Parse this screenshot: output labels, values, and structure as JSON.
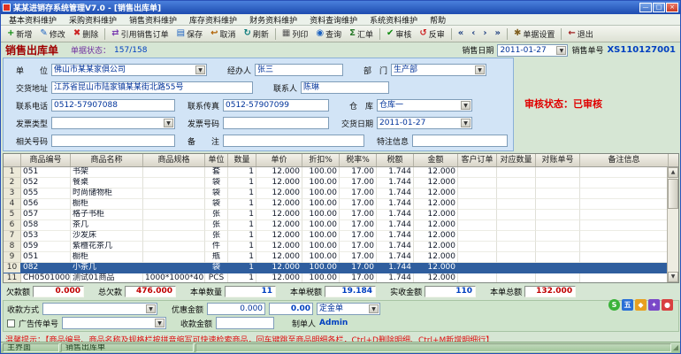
{
  "window": {
    "title": "某某进销存系统管理V7.0 - [销售出库单]",
    "controls": {
      "min": "—",
      "max": "□",
      "close": "×"
    }
  },
  "menu": {
    "items": [
      "基本资料维护",
      "采购资料维护",
      "销售资料维护",
      "库存资料维护",
      "财务资料维护",
      "资料查询维护",
      "系统资料维护",
      "帮助"
    ]
  },
  "toolbar": {
    "groups": [
      [
        {
          "label": "新增",
          "icon": "new-icon"
        },
        {
          "label": "修改",
          "icon": "edit-icon"
        },
        {
          "label": "删除",
          "icon": "delete-icon"
        }
      ],
      [
        {
          "label": "引用销售订单",
          "icon": "ref-order-icon"
        },
        {
          "label": "保存",
          "icon": "save-icon"
        },
        {
          "label": "取消",
          "icon": "cancel-icon"
        },
        {
          "label": "刷新",
          "icon": "refresh-icon"
        }
      ],
      [
        {
          "label": "列印",
          "icon": "print-icon"
        },
        {
          "label": "查询",
          "icon": "query-icon"
        },
        {
          "label": "汇单",
          "icon": "collect-icon"
        }
      ],
      [
        {
          "label": "审核",
          "icon": "audit-icon"
        },
        {
          "label": "反审",
          "icon": "unaudit-icon"
        }
      ],
      [
        {
          "label": "",
          "icon": "nav-first-icon"
        },
        {
          "label": "",
          "icon": "nav-prev-icon"
        },
        {
          "label": "",
          "icon": "nav-next-icon"
        },
        {
          "label": "",
          "icon": "nav-last-icon"
        }
      ],
      [
        {
          "label": "单据设置",
          "icon": "settings-icon"
        }
      ],
      [
        {
          "label": "退出",
          "icon": "exit-icon"
        }
      ]
    ]
  },
  "form": {
    "title": "销售出库单",
    "doc_state_label": "单据状态：",
    "doc_state_value": "157/158",
    "date_label": "销售日期",
    "date_value": "2011-01-27",
    "no_label": "销售单号",
    "no_value": "XS110127001",
    "audit_label": "审核状态：",
    "audit_value": "已审核"
  },
  "fields": {
    "unit_label": "单　　位",
    "unit_value": "佛山市某某家俱公司",
    "agent_label": "经办人",
    "agent_value": "张三",
    "dept_label": "部　门",
    "dept_value": "生产部",
    "addr_label": "交货地址",
    "addr_value": "江苏省昆山市陆家镇某某街北路55号",
    "contact_label": "联系人",
    "contact_value": "陈琳",
    "phone_label": "联系电话",
    "phone_value": "0512-57907088",
    "fax_label": "联系传真",
    "fax_value": "0512-57907099",
    "wh_label": "仓　库",
    "wh_value": "仓库一",
    "inv_type_label": "发票类型",
    "inv_type_value": "",
    "inv_no_label": "发票号码",
    "inv_no_value": "",
    "deliver_date_label": "交货日期",
    "deliver_date_value": "2011-01-27",
    "rel_no_label": "相关号码",
    "rel_no_value": "",
    "remark_label": "备　　注",
    "remark_value": "",
    "special_label": "特注信息",
    "special_value": ""
  },
  "table": {
    "columns": [
      "商品编号",
      "商品名称",
      "商品规格",
      "单位",
      "数量",
      "单价",
      "折扣%",
      "税率%",
      "税额",
      "金额",
      "客户订单",
      "对应数量",
      "对账单号",
      "备注信息"
    ],
    "selected_index": 9,
    "rows": [
      [
        "051",
        "书架",
        "",
        "套",
        "1",
        "12.000",
        "100.00",
        "17.00",
        "1.744",
        "12.000",
        "",
        "",
        "",
        ""
      ],
      [
        "052",
        "餐桌",
        "",
        "袋",
        "1",
        "12.000",
        "100.00",
        "17.00",
        "1.744",
        "12.000",
        "",
        "",
        "",
        ""
      ],
      [
        "055",
        "时尚储物柜",
        "",
        "袋",
        "1",
        "12.000",
        "100.00",
        "17.00",
        "1.744",
        "12.000",
        "",
        "",
        "",
        ""
      ],
      [
        "056",
        "橱柜",
        "",
        "袋",
        "1",
        "12.000",
        "100.00",
        "17.00",
        "1.744",
        "12.000",
        "",
        "",
        "",
        ""
      ],
      [
        "057",
        "格子书柜",
        "",
        "张",
        "1",
        "12.000",
        "100.00",
        "17.00",
        "1.744",
        "12.000",
        "",
        "",
        "",
        ""
      ],
      [
        "058",
        "茶几",
        "",
        "张",
        "1",
        "12.000",
        "100.00",
        "17.00",
        "1.744",
        "12.000",
        "",
        "",
        "",
        ""
      ],
      [
        "053",
        "沙发床",
        "",
        "张",
        "1",
        "12.000",
        "100.00",
        "17.00",
        "1.744",
        "12.000",
        "",
        "",
        "",
        ""
      ],
      [
        "059",
        "紫檀花茶几",
        "",
        "件",
        "1",
        "12.000",
        "100.00",
        "17.00",
        "1.744",
        "12.000",
        "",
        "",
        "",
        ""
      ],
      [
        "051",
        "橱柜",
        "",
        "瓶",
        "1",
        "12.000",
        "100.00",
        "17.00",
        "1.744",
        "12.000",
        "",
        "",
        "",
        ""
      ],
      [
        "082",
        "小茶几",
        "",
        "袋",
        "1",
        "12.000",
        "100.00",
        "17.00",
        "1.744",
        "12.000",
        "",
        "",
        "",
        ""
      ],
      [
        "CH05010001",
        "测试01商品",
        "1000*1000*40",
        "PCS",
        "1",
        "12.000",
        "100.00",
        "17.00",
        "1.744",
        "12.000",
        "",
        "",
        "",
        ""
      ]
    ]
  },
  "totals": {
    "items": [
      {
        "label": "欠款额",
        "value": "0.000",
        "color": "#c00000"
      },
      {
        "label": "总欠款",
        "value": "476.000",
        "color": "#c00000"
      },
      {
        "label": "本单数量",
        "value": "11",
        "color": "#0040c0"
      },
      {
        "label": "本单税额",
        "value": "19.184",
        "color": "#0040c0"
      },
      {
        "label": "实收金额",
        "value": "110",
        "color": "#0040c0"
      },
      {
        "label": "本单总额",
        "value": "132.000",
        "color": "#c00000"
      }
    ]
  },
  "payment": {
    "method_label": "收款方式",
    "method_value": "",
    "discount_label": "优惠金额",
    "discount_value": "0.000",
    "balance_value": "0.00",
    "deposit_label": "定金单",
    "promo_label": "广告传单号",
    "promo_value": "",
    "receive_label": "收款金额",
    "receive_value": "",
    "maker_label": "制单人",
    "maker_value": "Admin"
  },
  "tray": {
    "icons": [
      {
        "name": "skype-icon",
        "glyph": "S",
        "bg": "#3bb33a"
      },
      {
        "name": "ime-icon",
        "glyph": "五",
        "bg": "#2a6fd6"
      },
      {
        "name": "tray-icon-1",
        "glyph": "◆",
        "bg": "#e8a020"
      },
      {
        "name": "tray-icon-2",
        "glyph": "✦",
        "bg": "#7a48c8"
      },
      {
        "name": "tray-icon-3",
        "glyph": "●",
        "bg": "#d84040"
      }
    ]
  },
  "hint": {
    "text": "温馨提示：【商品编号、商品名称及规格栏按拼音缩写可快速检索商品，回车键跳至商品明细各栏，Ctrl+D删除明细、Ctrl+M新增明细行】"
  },
  "status": {
    "items": [
      "主界面",
      "销售出库单"
    ]
  }
}
